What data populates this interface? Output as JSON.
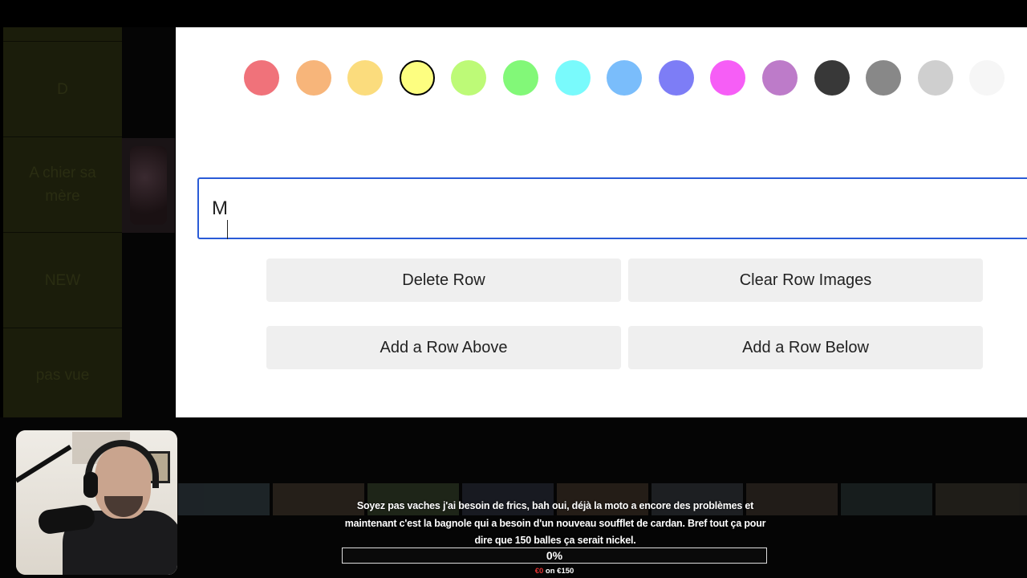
{
  "tier_list": {
    "tiers": [
      {
        "label": ""
      },
      {
        "label": "D"
      },
      {
        "label": "A chier sa mère"
      },
      {
        "label": "NEW"
      },
      {
        "label": "pas vue"
      }
    ]
  },
  "modal": {
    "swatches": [
      {
        "name": "red",
        "color": "#f0727a",
        "selected": false
      },
      {
        "name": "orange",
        "color": "#f7b57a",
        "selected": false
      },
      {
        "name": "light-orange",
        "color": "#fbdc7d",
        "selected": false
      },
      {
        "name": "yellow",
        "color": "#fdfe80",
        "selected": true
      },
      {
        "name": "lime",
        "color": "#bdfa77",
        "selected": false
      },
      {
        "name": "green",
        "color": "#82f878",
        "selected": false
      },
      {
        "name": "cyan",
        "color": "#79fafc",
        "selected": false
      },
      {
        "name": "sky-blue",
        "color": "#7abdfb",
        "selected": false
      },
      {
        "name": "indigo",
        "color": "#7d7df6",
        "selected": false
      },
      {
        "name": "magenta",
        "color": "#f65ef6",
        "selected": false
      },
      {
        "name": "purple",
        "color": "#bd7bc9",
        "selected": false
      },
      {
        "name": "dark-gray",
        "color": "#383838",
        "selected": false
      },
      {
        "name": "gray",
        "color": "#888888",
        "selected": false
      },
      {
        "name": "light-gray",
        "color": "#cfcfcf",
        "selected": false
      },
      {
        "name": "white",
        "color": "#f6f6f6",
        "selected": false
      }
    ],
    "row_label_value": "M",
    "buttons": {
      "delete_row": "Delete Row",
      "clear_row_images": "Clear Row Images",
      "add_row_above": "Add a Row Above",
      "add_row_below": "Add a Row Below"
    }
  },
  "stream_overlay": {
    "donation_message": "Soyez pas vaches j'ai besoin de frics, bah oui, déjà la moto a encore des problèmes et maintenant c'est la bagnole qui a besoin d'un nouveau soufflet de cardan. Bref tout ça pour dire que 150 balles ça serait nickel.",
    "progress_percent": 0,
    "progress_label": "0%",
    "goal_current": "€0",
    "goal_separator": " on ",
    "goal_target": "€150",
    "current_color": "#e33333"
  }
}
